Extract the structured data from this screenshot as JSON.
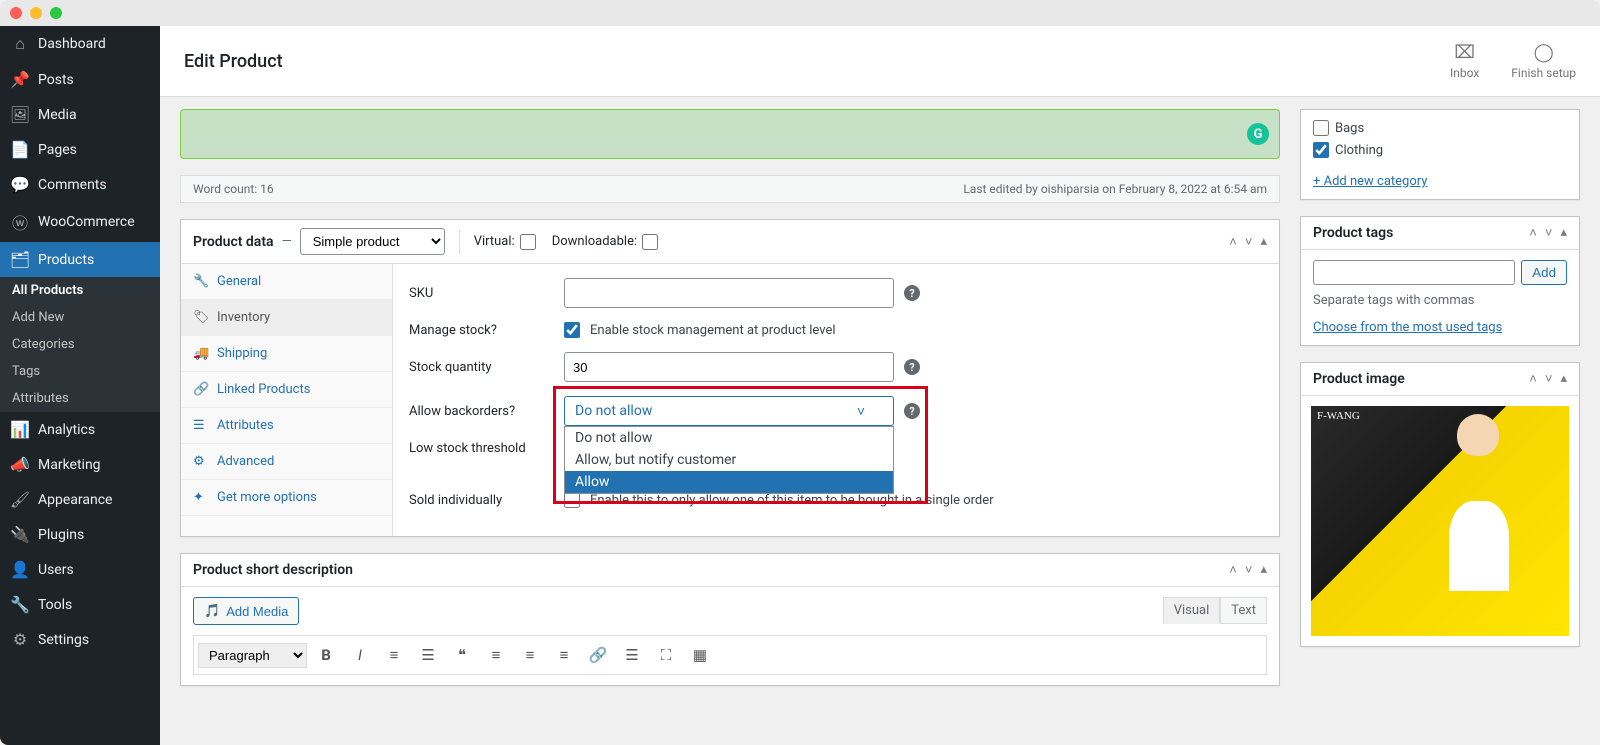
{
  "page_title": "Edit Product",
  "topbar_actions": {
    "inbox": "Inbox",
    "finish_setup": "Finish setup"
  },
  "sidebar_menu": {
    "dashboard": "Dashboard",
    "posts": "Posts",
    "media": "Media",
    "pages": "Pages",
    "comments": "Comments",
    "woocommerce": "WooCommerce",
    "products": "Products",
    "analytics": "Analytics",
    "marketing": "Marketing",
    "appearance": "Appearance",
    "plugins": "Plugins",
    "users": "Users",
    "tools": "Tools",
    "settings": "Settings"
  },
  "products_submenu": {
    "all": "All Products",
    "add": "Add New",
    "categories": "Categories",
    "tags": "Tags",
    "attributes": "Attributes"
  },
  "editor_status": {
    "word_count_label": "Word count: 16",
    "last_edited": "Last edited by oishiparsia on February 8, 2022 at 6:54 am"
  },
  "product_data": {
    "title": "Product data",
    "type_selected": "Simple product",
    "virtual_label": "Virtual:",
    "downloadable_label": "Downloadable:",
    "tabs": {
      "general": "General",
      "inventory": "Inventory",
      "shipping": "Shipping",
      "linked": "Linked Products",
      "attributes": "Attributes",
      "advanced": "Advanced",
      "get_more": "Get more options"
    },
    "inventory": {
      "sku_label": "SKU",
      "sku_value": "",
      "manage_stock_label": "Manage stock?",
      "manage_stock_desc": "Enable stock management at product level",
      "stock_qty_label": "Stock quantity",
      "stock_qty_value": "30",
      "backorders_label": "Allow backorders?",
      "backorders_selected": "Do not allow",
      "backorders_options": [
        "Do not allow",
        "Allow, but notify customer",
        "Allow"
      ],
      "low_stock_label": "Low stock threshold",
      "sold_individually_label": "Sold individually",
      "sold_individually_desc": "Enable this to only allow one of this item to be bought in a single order"
    }
  },
  "short_desc": {
    "title": "Product short description",
    "add_media": "Add Media",
    "visual": "Visual",
    "text": "Text",
    "paragraph": "Paragraph"
  },
  "categories": {
    "bags": "Bags",
    "clothing": "Clothing",
    "add_new": "+ Add new category"
  },
  "tags": {
    "title": "Product tags",
    "add": "Add",
    "help": "Separate tags with commas",
    "choose": "Choose from the most used tags"
  },
  "product_image": {
    "title": "Product image",
    "brand": "F-WANG"
  }
}
